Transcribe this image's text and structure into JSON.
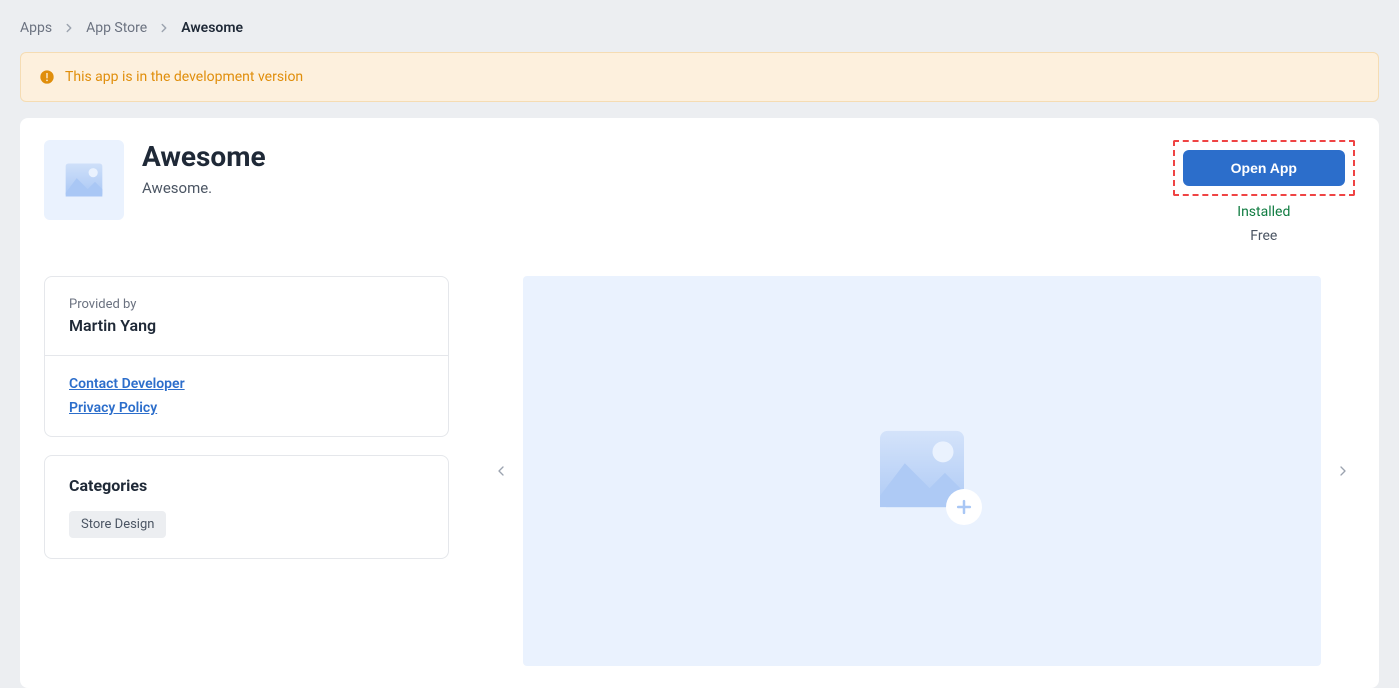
{
  "breadcrumb": {
    "items": [
      {
        "label": "Apps"
      },
      {
        "label": "App Store"
      },
      {
        "label": "Awesome"
      }
    ]
  },
  "alert": {
    "message": "This app is in the development version"
  },
  "app": {
    "title": "Awesome",
    "subtitle": "Awesome.",
    "open_button_label": "Open App",
    "installed_label": "Installed",
    "price_label": "Free"
  },
  "provider": {
    "label": "Provided by",
    "name": "Martin Yang",
    "links": [
      {
        "label": "Contact Developer"
      },
      {
        "label": "Privacy Policy"
      }
    ]
  },
  "categories": {
    "title": "Categories",
    "items": [
      {
        "label": "Store Design"
      }
    ]
  }
}
